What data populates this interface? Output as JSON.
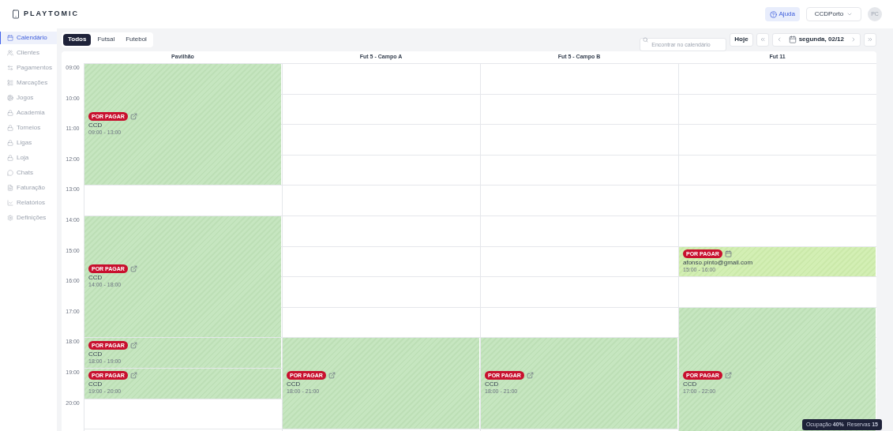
{
  "header": {
    "logo": "PLAYTOMIC",
    "help": "Ajuda",
    "club": "CCDPorto",
    "avatar": "PC"
  },
  "sidebar": {
    "items": [
      {
        "label": "Calendário",
        "selected": true
      },
      {
        "label": "Clientes",
        "selected": false
      },
      {
        "label": "Pagamentos",
        "selected": false
      },
      {
        "label": "Marcações",
        "selected": false
      },
      {
        "label": "Jogos",
        "selected": false
      },
      {
        "label": "Academia",
        "selected": false
      },
      {
        "label": "Torneios",
        "selected": false
      },
      {
        "label": "Ligas",
        "selected": false
      },
      {
        "label": "Loja",
        "selected": false
      },
      {
        "label": "Chats",
        "selected": false
      },
      {
        "label": "Faturação",
        "selected": false
      },
      {
        "label": "Relatórios",
        "selected": false
      },
      {
        "label": "Definições",
        "selected": false
      }
    ]
  },
  "tabs": [
    {
      "label": "Todos",
      "selected": true
    },
    {
      "label": "Futsal",
      "selected": false
    },
    {
      "label": "Futebol",
      "selected": false
    }
  ],
  "search": {
    "placeholder": "Encontrar no calendário"
  },
  "today": "Hoje",
  "date": "segunda, 02/12",
  "hours": [
    "09:00",
    "10:00",
    "11:00",
    "12:00",
    "13:00",
    "14:00",
    "15:00",
    "16:00",
    "17:00",
    "18:00",
    "19:00",
    "20:00"
  ],
  "columns": [
    {
      "title": "Pavilhão",
      "events": [
        {
          "kind": "link",
          "badge": "POR PAGAR",
          "name": "CCD",
          "time": "09:00 - 13:00"
        },
        {
          "kind": "link",
          "badge": "POR PAGAR",
          "name": "CCD",
          "time": "14:00 - 18:00"
        },
        {
          "kind": "link",
          "badge": "POR PAGAR",
          "name": "CCD",
          "time": "18:00 - 19:00"
        },
        {
          "kind": "link",
          "badge": "POR PAGAR",
          "name": "CCD",
          "time": "19:00 - 20:00"
        }
      ]
    },
    {
      "title": "Fut 5 - Campo A",
      "events": [
        {
          "kind": "link",
          "badge": "POR PAGAR",
          "name": "CCD",
          "time": "18:00 - 21:00"
        }
      ]
    },
    {
      "title": "Fut 5 - Campo B",
      "events": [
        {
          "kind": "link",
          "badge": "POR PAGAR",
          "name": "CCD",
          "time": "18:00 - 21:00"
        }
      ]
    },
    {
      "title": "Fut 11",
      "events": [
        {
          "kind": "calendar",
          "badge": "POR PAGAR",
          "name": "afonso.pinto@gmail.com",
          "time": "15:00 - 16:00"
        },
        {
          "kind": "link",
          "badge": "POR PAGAR",
          "name": "CCD",
          "time": "17:00 - 22:00"
        }
      ]
    }
  ],
  "stats": "Ocupação **40%**  Reservas **15**"
}
